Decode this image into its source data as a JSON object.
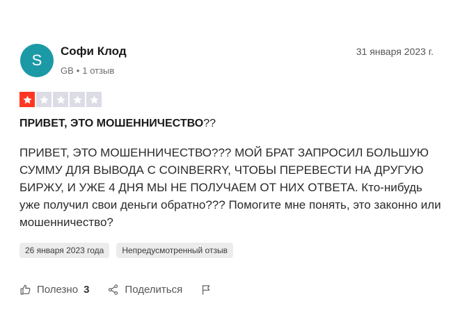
{
  "author": {
    "avatar_letter": "S",
    "avatar_color": "#1b9aa6",
    "name": "Софи Клод",
    "country": "GB",
    "separator": "•",
    "reviews_count": "1 отзыв"
  },
  "review": {
    "date": "31 января 2023 г.",
    "rating": 1,
    "rating_max": 5,
    "star_active_color": "#ff3722",
    "star_inactive_color": "#dcdce6",
    "title_bold": "ПРИВЕТ, ЭТО МОШЕННИЧЕСТВО",
    "title_rest": "??",
    "body": "ПРИВЕТ, ЭТО МОШЕННИЧЕСТВО??? МОЙ БРАТ ЗАПРОСИЛ БОЛЬШУЮ СУММУ ДЛЯ ВЫВОДА С COINBERRY, ЧТОБЫ ПЕРЕВЕСТИ НА ДРУГУЮ БИРЖУ, И УЖЕ 4 ДНЯ МЫ НЕ ПОЛУЧАЕМ ОТ НИХ ОТВЕТА. Кто-нибудь уже получил свои деньги обратно??? Помогите мне понять, это законно или мошенничество?",
    "experience_date": "26 января 2023 года",
    "tag_unprompted": "Непредусмотренный отзыв"
  },
  "actions": {
    "useful_label": "Полезно",
    "useful_count": "3",
    "useful_icon": "thumbs-up-icon",
    "share_label": "Поделиться",
    "share_icon": "share-icon",
    "flag_icon": "flag-icon"
  }
}
